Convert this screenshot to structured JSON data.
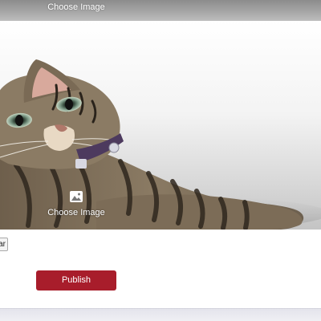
{
  "top_card": {
    "choose_label": "Choose Image"
  },
  "image_card": {
    "choose_label": "Choose Image",
    "icon": "image-icon"
  },
  "clear_button": {
    "label": "ar"
  },
  "publish_button": {
    "label": "Publish",
    "color": "#a81d2b"
  }
}
